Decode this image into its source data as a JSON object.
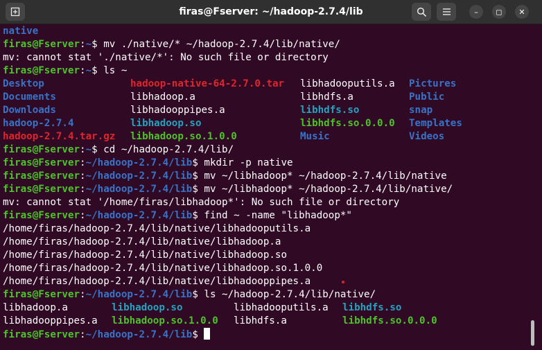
{
  "window": {
    "title": "firas@Fserver: ~/hadoop-2.7.4/lib",
    "buttons": {
      "new_tab_icon": "new-tab-icon",
      "search_icon": "search-icon",
      "menu_icon": "hamburger-menu-icon",
      "minimize": "–",
      "maximize": "◻",
      "close": "✕"
    }
  },
  "prompt": {
    "user": "firas@Fserver",
    "sep": ":",
    "home": "~",
    "lib": "~/hadoop-2.7.4/lib",
    "dollar": "$"
  },
  "lines": {
    "l0": "native",
    "l1_cmd": " mv ./native/* ~/hadoop-2.7.4/lib/native/",
    "l2": "mv: cannot stat './native/*': No such file or directory",
    "l3_cmd": " ls ~",
    "ls_home": {
      "r0": [
        "Desktop",
        "hadoop-native-64-2.7.0.tar",
        "libhadooputils.a",
        "Pictures"
      ],
      "r1": [
        "Documents",
        "libhadoop.a",
        "libhdfs.a",
        "Public"
      ],
      "r2": [
        "Downloads",
        "libhadooppipes.a",
        "libhdfs.so",
        "snap"
      ],
      "r3": [
        "hadoop-2.7.4",
        "libhadoop.so",
        "libhdfs.so.0.0.0",
        "Templates"
      ],
      "r4": [
        "hadoop-2.7.4.tar.gz",
        "libhadoop.so.1.0.0",
        "Music",
        "Videos"
      ]
    },
    "l9_cmd": " cd ~/hadoop-2.7.4/lib/",
    "l10_cmd": " mkdir -p native",
    "l11_cmd": " mv ~/libhadoop* ~/hadoop-2.7.4/lib/native",
    "l12_cmd": " mv ~/libhadoop* ~/hadoop-2.7.4/lib/native/",
    "l13": "mv: cannot stat '/home/firas/libhadoop*': No such file or directory",
    "l14_cmd": " find ~ -name \"libhadoop*\"",
    "l15": "/home/firas/hadoop-2.7.4/lib/native/libhadooputils.a",
    "l16": "/home/firas/hadoop-2.7.4/lib/native/libhadoop.a",
    "l17": "/home/firas/hadoop-2.7.4/lib/native/libhadoop.so",
    "l18": "/home/firas/hadoop-2.7.4/lib/native/libhadoop.so.1.0.0",
    "l19": "/home/firas/hadoop-2.7.4/lib/native/libhadooppipes.a",
    "l20_cmd": " ls ~/hadoop-2.7.4/lib/native/",
    "ls_native": {
      "r0": [
        "libhadoop.a",
        "libhadoop.so",
        "libhadooputils.a",
        "libhdfs.so"
      ],
      "r1": [
        "libhadooppipes.a",
        "libhadoop.so.1.0.0",
        "libhdfs.a",
        "libhdfs.so.0.0.0"
      ]
    }
  },
  "colors": {
    "background": "#300a24",
    "prompt_user": "#4ec22b",
    "prompt_path": "#3873c7",
    "directory": "#3873c7",
    "archive": "#e0242c",
    "executable": "#4ec22b",
    "symlink": "#24a2bf"
  }
}
